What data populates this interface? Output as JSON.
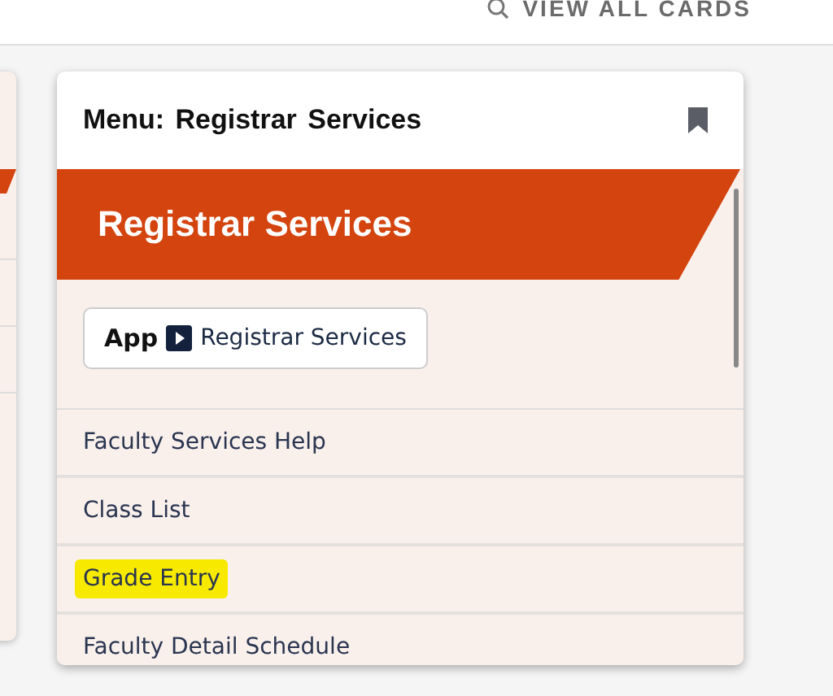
{
  "top_bar": {
    "link": "VIEW ALL CARDS"
  },
  "card": {
    "title": "Menu: Registrar Services",
    "bookmarked": true,
    "banner": "Registrar Services",
    "app_button": {
      "tag": "App",
      "label": "Registrar Services"
    },
    "items": [
      {
        "label": "Faculty Services Help",
        "highlighted": false
      },
      {
        "label": "Class List",
        "highlighted": false
      },
      {
        "label": "Grade Entry",
        "highlighted": true
      },
      {
        "label": "Faculty Detail Schedule",
        "highlighted": false
      }
    ]
  }
}
